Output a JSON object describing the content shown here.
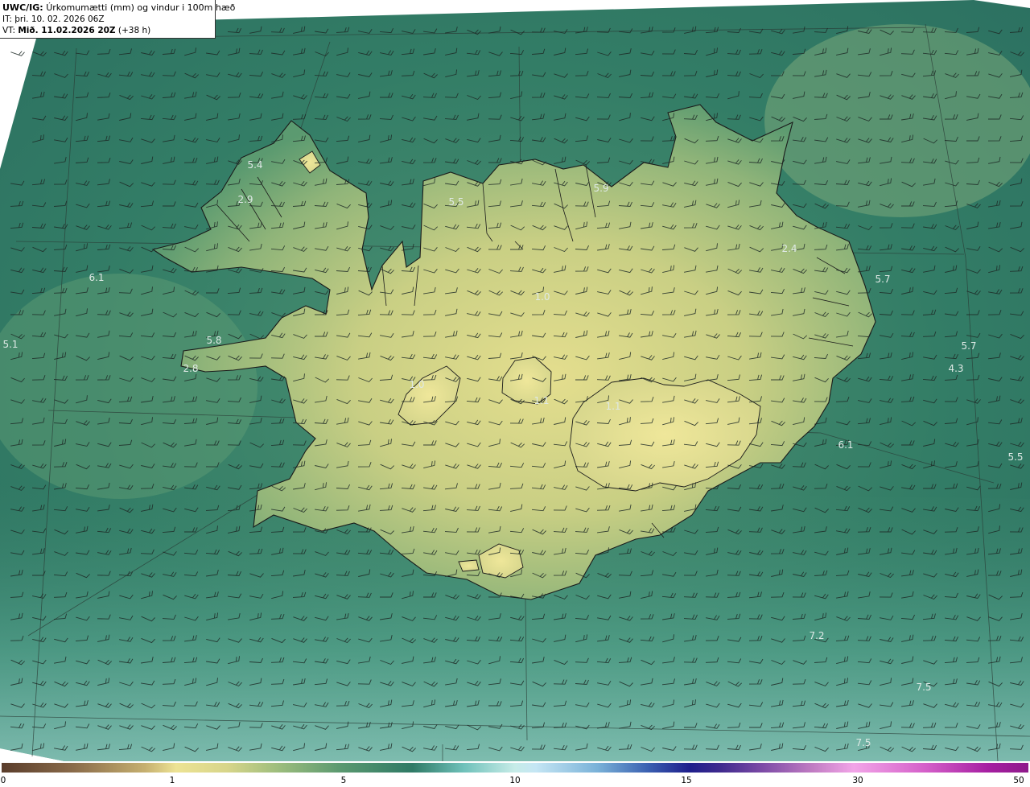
{
  "header": {
    "product": "UWC/IG:",
    "title": "Úrkomumætti (mm) og vindur i 100m hæð",
    "init_label": "IT:",
    "init_time": "þri. 10. 02. 2026 06Z",
    "valid_label": "VT:",
    "valid_time": "Mið. 11.02.2026 20Z",
    "lead_time": "(+38 h)"
  },
  "colorbar": {
    "ticks": [
      "0",
      "1",
      "5",
      "10",
      "15",
      "30",
      "50"
    ]
  },
  "value_labels": [
    {
      "id": "westfjords-north",
      "text": "5.4"
    },
    {
      "id": "westfjords-mid",
      "text": "2.9"
    },
    {
      "id": "west-sea",
      "text": "6.1"
    },
    {
      "id": "far-west",
      "text": "5.1"
    },
    {
      "id": "snaefellsnes",
      "text": "5.8"
    },
    {
      "id": "snaefellsnes-tip",
      "text": "2.8"
    },
    {
      "id": "north-skagi",
      "text": "5.5"
    },
    {
      "id": "north-eyjafjordur",
      "text": "5.9"
    },
    {
      "id": "northeast",
      "text": "2.4"
    },
    {
      "id": "east-coast",
      "text": "5.7"
    },
    {
      "id": "east-sea",
      "text": "5.7"
    },
    {
      "id": "east-sea-2",
      "text": "4.3"
    },
    {
      "id": "southeast",
      "text": "6.1"
    },
    {
      "id": "far-east",
      "text": "5.5"
    },
    {
      "id": "south-sea",
      "text": "7.2"
    },
    {
      "id": "south-sea-2",
      "text": "7.5"
    },
    {
      "id": "south-sea-3",
      "text": "7.5"
    },
    {
      "id": "vatnajokull",
      "text": "1.1"
    },
    {
      "id": "hofsjokull",
      "text": "1.1"
    },
    {
      "id": "north-interior",
      "text": "1.0"
    },
    {
      "id": "langjokull",
      "text": "1.0"
    }
  ],
  "colors": {
    "sea_dark": "#2e6e5c",
    "sea_mid": "#3f8a6e",
    "land_light": "#dcdb8e",
    "coast": "#1a1a1a"
  }
}
